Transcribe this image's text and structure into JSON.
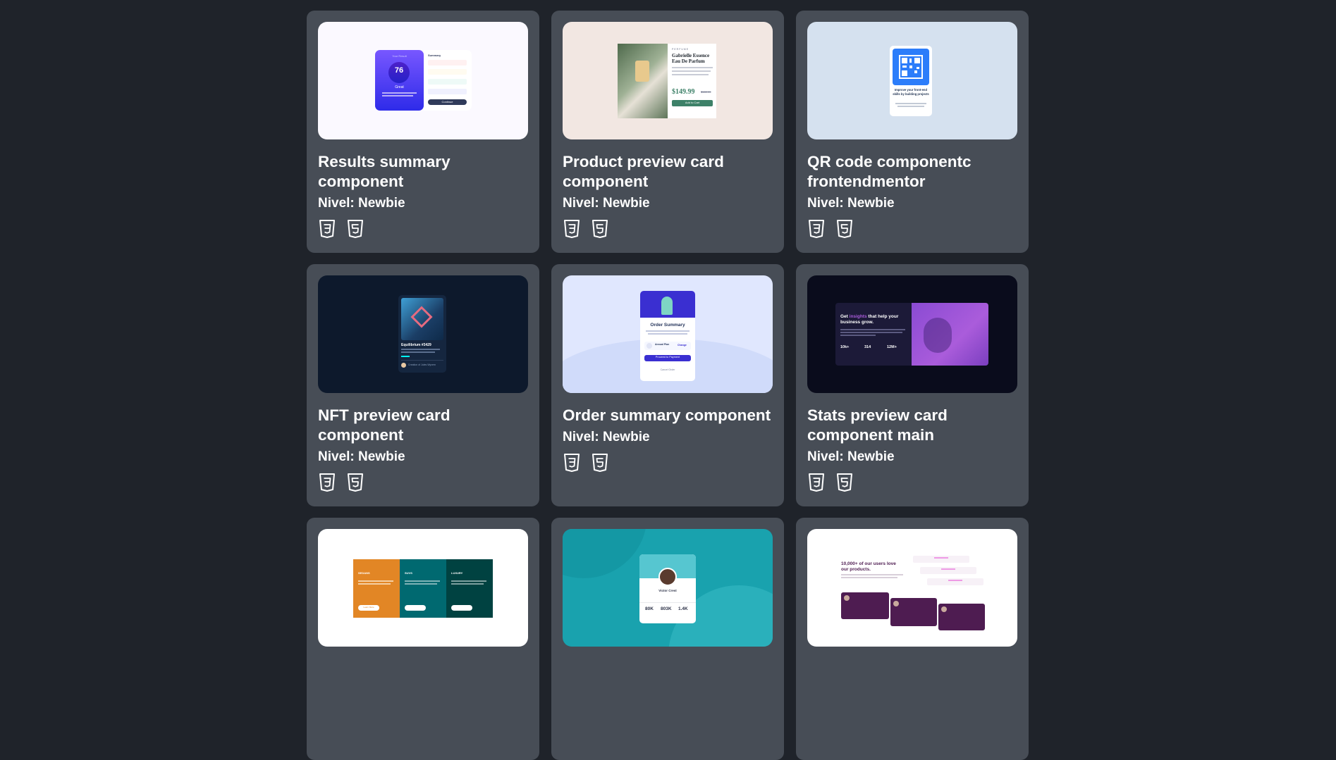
{
  "cards": [
    {
      "title": "Results summary component",
      "level": "Nivel: Newbie",
      "thumb": {
        "left_title": "Your Result",
        "score": "76",
        "score_sub": "of 100",
        "rating": "Great",
        "summary_title": "Summary",
        "summary_items": [
          "Reaction",
          "Memory",
          "Verbal",
          "Visual"
        ],
        "summary_scores": [
          "80",
          "92",
          "61",
          "72"
        ],
        "button": "Continue"
      }
    },
    {
      "title": "Product preview card component",
      "level": "Nivel: Newbie",
      "thumb": {
        "kicker": "PERFUME",
        "name": "Gabrielle Essence Eau De Parfum",
        "price": "$149.99",
        "old_price": "$169.99",
        "button": "Add to Cart"
      }
    },
    {
      "title": "QR code componentc frontendmentor",
      "level": "Nivel: Newbie",
      "thumb": {
        "heading": "Improve your front-end skills by building projects"
      }
    },
    {
      "title": "NFT preview card component",
      "level": "Nivel: Newbie",
      "thumb": {
        "name": "Equilibrium #3429",
        "creator": "Creation of Jules Wyvern"
      }
    },
    {
      "title": "Order summary component",
      "level": "Nivel: Newbie",
      "thumb": {
        "heading": "Order Summary",
        "plan": "Annual Plan",
        "change": "Change",
        "button": "Proceed to Payment",
        "cancel": "Cancel Order"
      }
    },
    {
      "title": "Stats preview card component main",
      "level": "Nivel: Newbie",
      "thumb": {
        "heading_pre": "Get ",
        "heading_hl": "insights",
        "heading_post": " that help your business grow.",
        "stats": [
          "10k+",
          "314",
          "12M+"
        ]
      }
    },
    {
      "title": "",
      "level": "",
      "thumb": {
        "labels": [
          "SEDANS",
          "SUVS",
          "LUXURY"
        ],
        "button": "Learn More"
      }
    },
    {
      "title": "",
      "level": "",
      "thumb": {
        "name": "Victor Crest",
        "stats": [
          "80K",
          "803K",
          "1.4K"
        ]
      }
    },
    {
      "title": "",
      "level": "",
      "thumb": {
        "heading": "10,000+ of our users love our products."
      }
    }
  ],
  "colors": {
    "page_bg": "#1f232a",
    "card_bg": "#474d56",
    "text": "#ffffff"
  },
  "icons": [
    "css3-icon",
    "html5-icon"
  ]
}
